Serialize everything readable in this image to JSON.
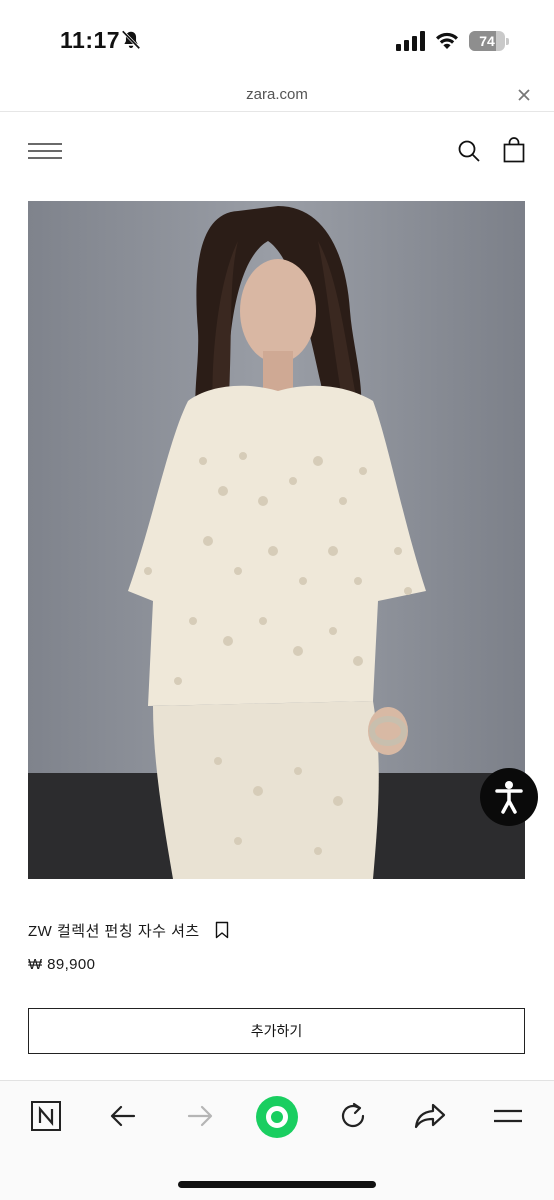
{
  "status_bar": {
    "time": "11:17",
    "battery_level": "74",
    "icons": [
      "bell-slash-icon",
      "cellular-signal-icon",
      "wifi-icon",
      "battery-charging-icon"
    ]
  },
  "browser": {
    "url": "zara.com",
    "close_icon": "close-icon"
  },
  "site_header": {
    "menu_icon": "hamburger-menu-icon",
    "search_icon": "search-icon",
    "bag_icon": "shopping-bag-icon"
  },
  "product": {
    "image_icon": "product-photo",
    "name": "ZW 컬렉션 펀칭 자수 셔츠",
    "bookmark_icon": "bookmark-icon",
    "price": "₩ 89,900",
    "add_label": "추가하기"
  },
  "accessibility": {
    "icon": "accessibility-person-icon"
  },
  "toolbar": {
    "items": [
      "naver-home-icon",
      "back-arrow-icon",
      "forward-arrow-icon",
      "green-home-circle-icon",
      "reload-icon",
      "share-icon",
      "menu-icon"
    ]
  },
  "colors": {
    "accent_green": "#19ce60",
    "a11y_bg": "#0a0a0a",
    "photo_wall": "#8c9099"
  }
}
